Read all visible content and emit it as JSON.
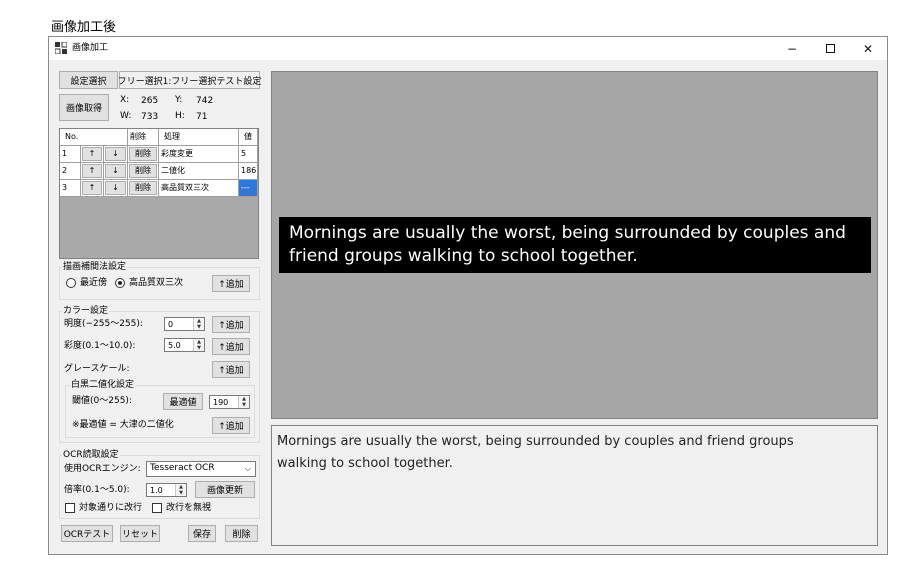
{
  "outer_caption": "画像加工後",
  "window": {
    "title": "画像加工",
    "minimize": "−",
    "close": "✕"
  },
  "top": {
    "settings_select_button": "設定選択",
    "settings_name": "フリー選択1:フリー選択テスト設定",
    "capture_button": "画像取得",
    "x_label": "X:",
    "x_value": "265",
    "y_label": "Y:",
    "y_value": "742",
    "w_label": "W:",
    "w_value": "733",
    "h_label": "H:",
    "h_value": "71"
  },
  "process_grid": {
    "headers": {
      "no": "No.",
      "delete": "削除",
      "process": "処理",
      "value": "値"
    },
    "up": "↑",
    "down": "↓",
    "delete": "削除",
    "rows": [
      {
        "no": "1",
        "process": "彩度変更",
        "value": "5"
      },
      {
        "no": "2",
        "process": "二値化",
        "value": "186"
      },
      {
        "no": "3",
        "process": "高品質双三次",
        "value": "---"
      }
    ]
  },
  "interpolation": {
    "title": "描画補間法設定",
    "option_nearest": "最近傍",
    "option_bicubic": "高品質双三次",
    "selected": "高品質双三次",
    "add_button": "↑追加"
  },
  "color": {
    "title": "カラー設定",
    "brightness_label": "明度(−255〜255):",
    "brightness_value": "0",
    "saturation_label": "彩度(0.1〜10.0):",
    "saturation_value": "5.0",
    "grayscale_label": "グレースケール:",
    "add_button": "↑追加"
  },
  "binarize": {
    "title": "白黒二値化設定",
    "threshold_label": "閾値(0〜255):",
    "optimal_button": "最適値",
    "threshold_value": "190",
    "note": "※最適値 = 大津の二値化",
    "add_button": "↑追加"
  },
  "ocr": {
    "title": "OCR読取設定",
    "engine_label": "使用OCRエンジン:",
    "engine_value": "Tesseract OCR",
    "scale_label": "倍率(0.1〜5.0):",
    "scale_value": "1.0",
    "refresh_button": "画像更新",
    "wrap_checkbox": "対象通りに改行",
    "ignore_newline_checkbox": "改行を無視"
  },
  "bottom": {
    "ocr_test": "OCRテスト",
    "reset": "リセット",
    "save": "保存",
    "delete": "削除"
  },
  "preview_text": "Mornings are usually the worst, being surrounded by couples and\nfriend groups walking to school together.",
  "ocr_result_text": "Mornings are usually the worst, being surrounded by couples and friend groups\nwalking to school together.",
  "colors": {
    "selection": "#3078d8",
    "preview_bg": "#a6a6a6",
    "subtitle_bg": "#000000"
  }
}
